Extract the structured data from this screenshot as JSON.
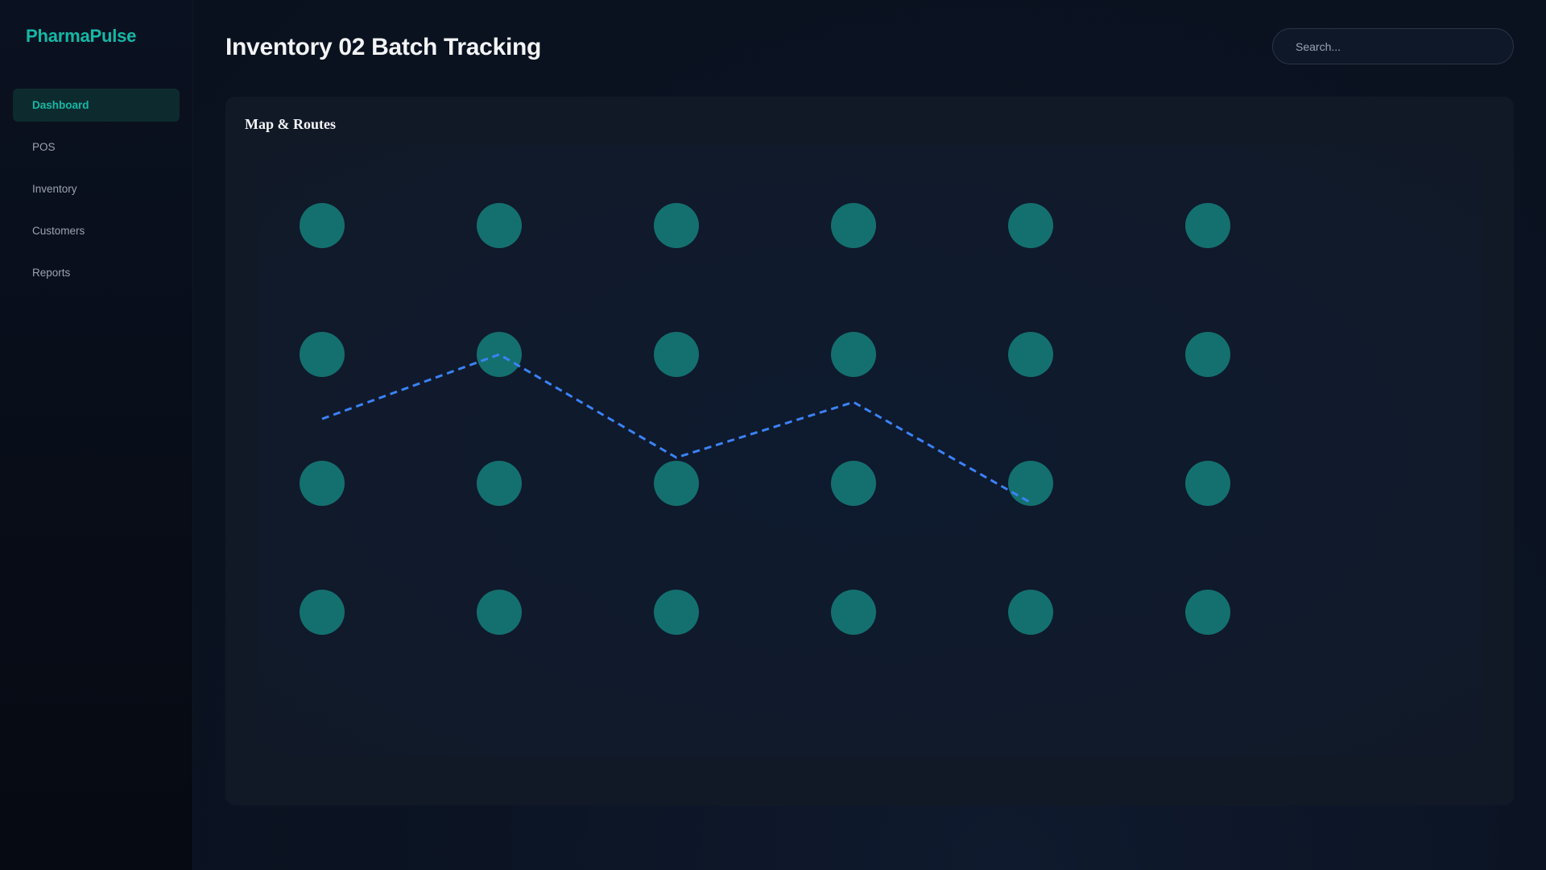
{
  "app": {
    "brand": "PharmaPulse"
  },
  "sidebar": {
    "items": [
      {
        "label": "Dashboard",
        "active": true
      },
      {
        "label": "POS",
        "active": false
      },
      {
        "label": "Inventory",
        "active": false
      },
      {
        "label": "Customers",
        "active": false
      },
      {
        "label": "Reports",
        "active": false
      }
    ]
  },
  "header": {
    "title": "Inventory 02 Batch Tracking",
    "search_placeholder": "Search..."
  },
  "panel": {
    "title": "Map & Routes"
  },
  "map": {
    "node_color": "#14706f",
    "route_color": "#3b82f6",
    "grid_rows": 4,
    "grid_cols": 6
  },
  "colors": {
    "accent": "#14b8a6",
    "background": "#0b1220",
    "panel": "#111927"
  }
}
